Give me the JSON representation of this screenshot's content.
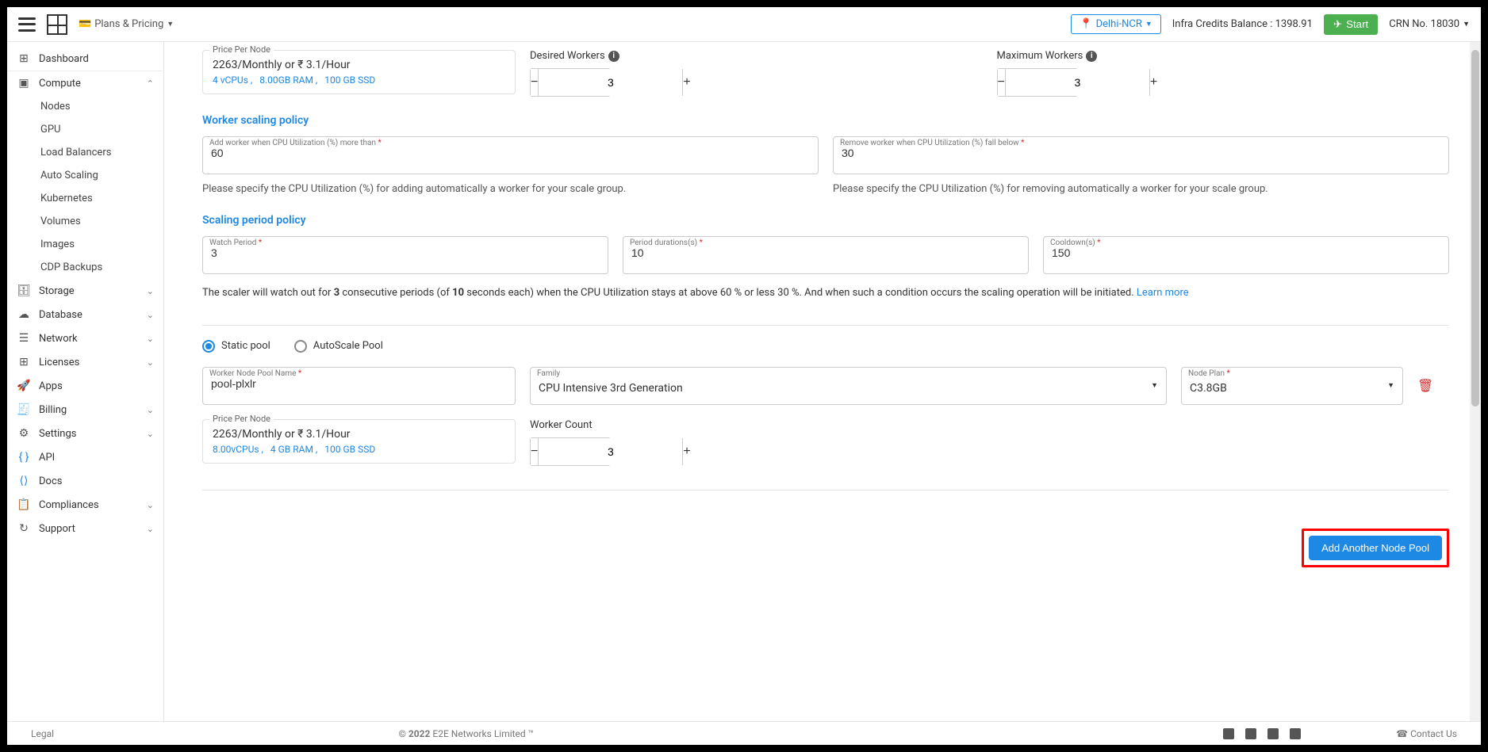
{
  "header": {
    "plans_label": "Plans & Pricing",
    "location": "Delhi-NCR",
    "credits_label": "Infra Credits Balance : 1398.91",
    "start_label": "Start",
    "crn_label": "CRN No. 18030"
  },
  "sidebar": {
    "items": [
      {
        "label": "Dashboard",
        "icon": "▦"
      },
      {
        "label": "Compute",
        "icon": "▣",
        "expanded": true,
        "children": [
          {
            "label": "Nodes"
          },
          {
            "label": "GPU"
          },
          {
            "label": "Load Balancers"
          },
          {
            "label": "Auto Scaling"
          },
          {
            "label": "Kubernetes"
          },
          {
            "label": "Volumes"
          },
          {
            "label": "Images"
          },
          {
            "label": "CDP Backups"
          }
        ]
      },
      {
        "label": "Storage",
        "icon": "🗄"
      },
      {
        "label": "Database",
        "icon": "☁"
      },
      {
        "label": "Network",
        "icon": "☰"
      },
      {
        "label": "Licenses",
        "icon": "⊞"
      },
      {
        "label": "Apps",
        "icon": "🚀"
      },
      {
        "label": "Billing",
        "icon": "🧾"
      },
      {
        "label": "Settings",
        "icon": "⚙"
      },
      {
        "label": "API",
        "icon": "{}"
      },
      {
        "label": "Docs",
        "icon": "⟨⟩"
      },
      {
        "label": "Compliances",
        "icon": "📋"
      },
      {
        "label": "Support",
        "icon": "↻"
      }
    ]
  },
  "pool1": {
    "price_label": "Price Per Node",
    "price_value": "2263/Monthly or ₹ 3.1/Hour",
    "spec_vcpu": "4   vCPUs ,",
    "spec_ram": "8.00GB RAM ,",
    "spec_ssd": "100 GB SSD",
    "desired_label": "Desired Workers",
    "desired_value": "3",
    "max_label": "Maximum Workers",
    "max_value": "3"
  },
  "scaling": {
    "title": "Worker scaling policy",
    "add_label": "Add worker when CPU Utilization (%) more than",
    "add_value": "60",
    "add_help": "Please specify the CPU Utilization (%) for adding automatically a worker for your scale group.",
    "remove_label": "Remove worker when CPU Utilization (%) fall below",
    "remove_value": "30",
    "remove_help": "Please specify the CPU Utilization (%) for removing automatically a worker for your scale group."
  },
  "period": {
    "title": "Scaling period policy",
    "watch_label": "Watch Period",
    "watch_value": "3",
    "duration_label": "Period durations(s)",
    "duration_value": "10",
    "cooldown_label": "Cooldown(s)",
    "cooldown_value": "150",
    "note_prefix": "The scaler will watch out for ",
    "note_bold1": "3",
    "note_mid1": " consecutive periods (of ",
    "note_bold2": "10",
    "note_mid2": " seconds each) when the CPU Utilization stays at above 60 % or less 30 %. And when such a condition occurs the scaling operation will be initiated. ",
    "learn": "Learn more"
  },
  "pool2": {
    "radio_static": "Static pool",
    "radio_auto": "AutoScale Pool",
    "name_label": "Worker Node Pool Name",
    "name_value": "pool-plxlr",
    "family_label": "Family",
    "family_value": "CPU Intensive 3rd Generation",
    "plan_label": "Node Plan",
    "plan_value": "C3.8GB",
    "price_label": "Price Per Node",
    "price_value": "2263/Monthly or ₹ 3.1/Hour",
    "spec_vcpu": "8.00vCPUs ,",
    "spec_ram": "4   GB RAM ,",
    "spec_ssd": "100 GB SSD",
    "worker_label": "Worker Count",
    "worker_value": "3"
  },
  "add_pool_btn": "Add Another Node Pool",
  "footer": {
    "legal": "Legal",
    "copyright": "© 2022 ",
    "company": "E2E Networks Limited ™",
    "contact": "Contact Us"
  }
}
